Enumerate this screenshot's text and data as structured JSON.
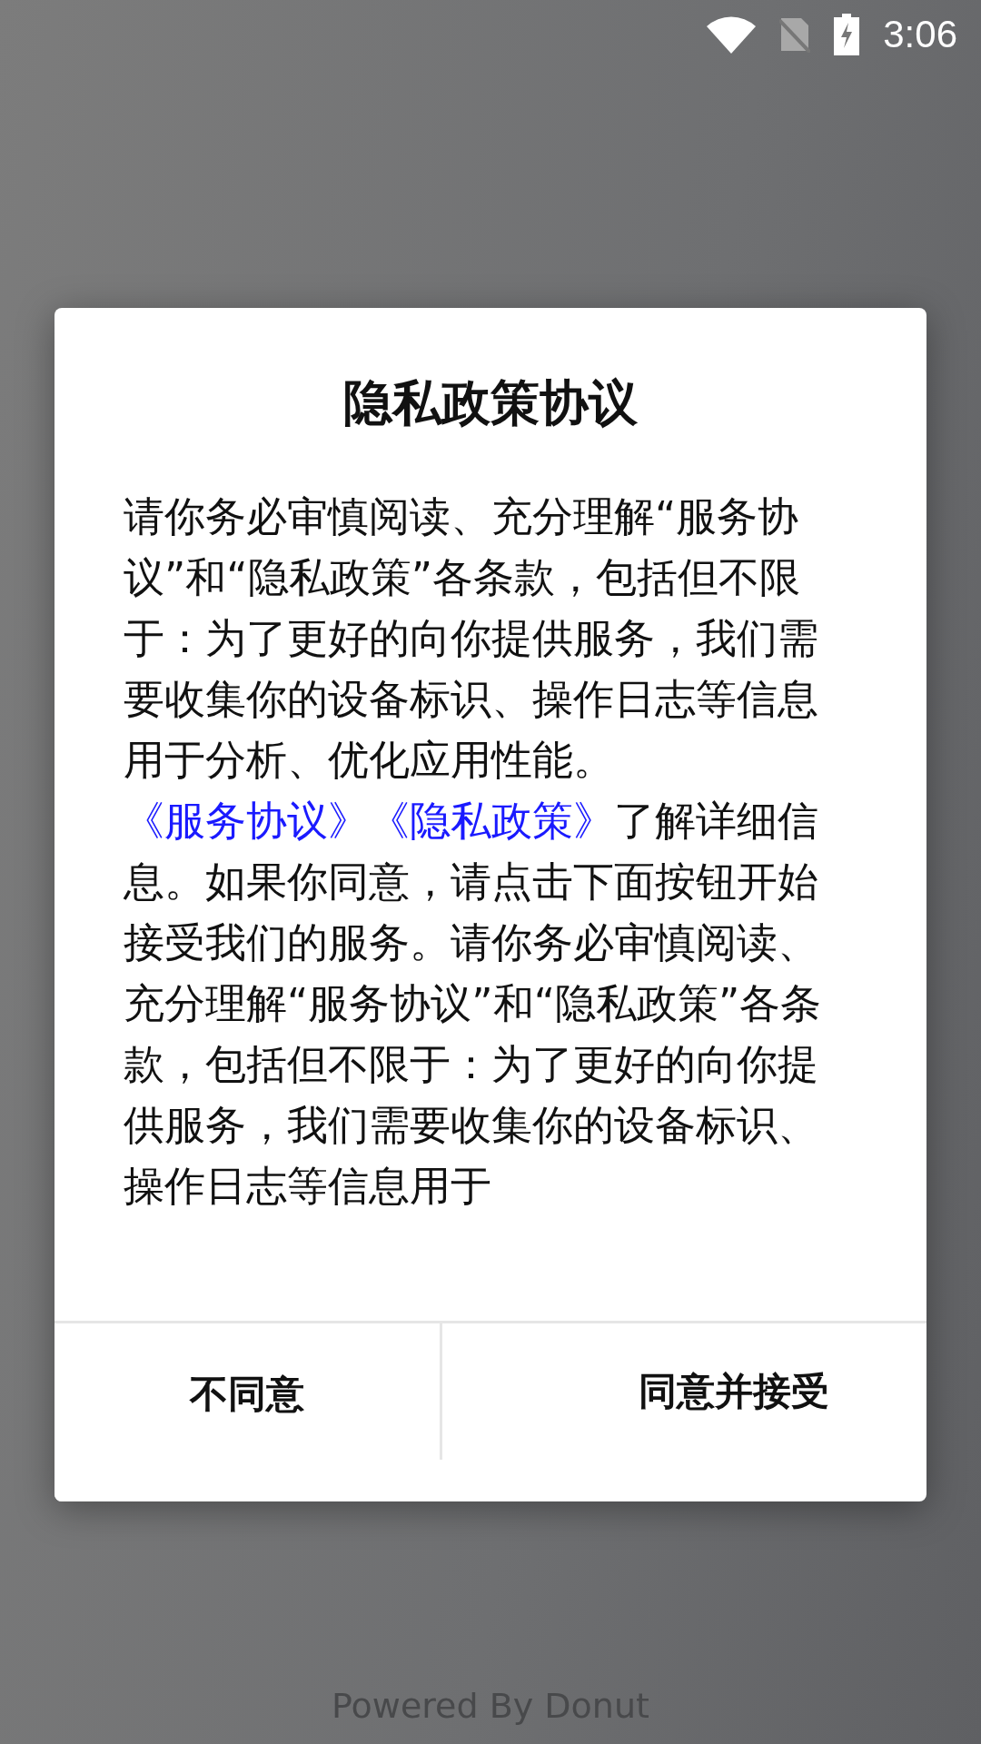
{
  "status_bar": {
    "time": "3:06"
  },
  "dialog": {
    "title": "隐私政策协议",
    "body": [
      {
        "kind": "text",
        "text": "请你务必审慎阅读、充分理解“服务协议”和“隐私政策”各条款，包括但不限于：为了更好的向你提供服务，我们需要收集你的设备标识、操作日志等信息用于分析、优化应用性能。"
      },
      {
        "kind": "link",
        "text": "《服务协议》"
      },
      {
        "kind": "link",
        "text": "《隐私政策》"
      },
      {
        "kind": "text",
        "text": "了解详细信息。如果你同意，请点击下面按钮开始接受我们的服务。请你务必审慎阅读、充分理解“服务协议”和“隐私政策”各条款，包括但不限于：为了更好的向你提供服务，我们需要收集你的设备标识、操作日志等信息用于"
      }
    ],
    "buttons": [
      {
        "label": "不同意"
      },
      {
        "label": "同意并接受"
      }
    ]
  },
  "footer": {
    "text": "Powered By Donut"
  }
}
